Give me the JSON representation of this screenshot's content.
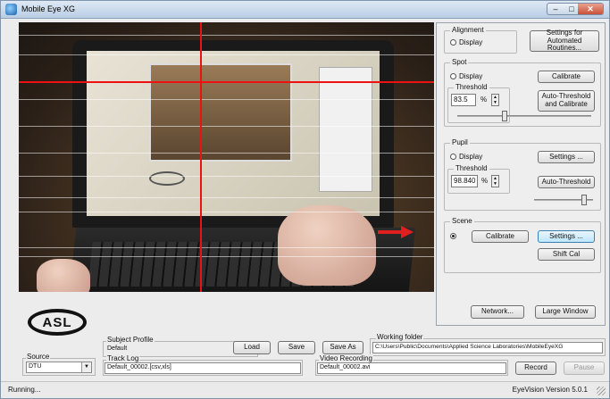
{
  "window": {
    "title": "Mobile Eye XG"
  },
  "alignment": {
    "label": "Alignment",
    "display_label": "Display",
    "settings_button": "Settings for\nAutomated Routines..."
  },
  "spot": {
    "label": "Spot",
    "display_label": "Display",
    "calibrate_button": "Calibrate",
    "threshold_label": "Threshold",
    "threshold_value": "83.5",
    "percent": "%",
    "auto_button": "Auto-Threshold\nand Calibrate",
    "slider_level": 0.35
  },
  "pupil": {
    "label": "Pupil",
    "display_label": "Display",
    "settings_button": "Settings ...",
    "threshold_label": "Threshold",
    "threshold_value": "98.840",
    "percent": "%",
    "auto_button": "Auto-Threshold",
    "slider_level": 0.85
  },
  "scene": {
    "label": "Scene",
    "calibrate_button": "Calibrate",
    "settings_button": "Settings ...",
    "shift_button": "Shift Cal"
  },
  "panel_buttons": {
    "network": "Network...",
    "large_window": "Large Window"
  },
  "logo": "ASL",
  "subject_profile": {
    "label": "Subject Profile",
    "value": "Default",
    "load": "Load",
    "save": "Save",
    "save_as": "Save As"
  },
  "working_folder": {
    "label": "Working folder",
    "value": "C:\\Users\\Public\\Documents\\Applied Science Laboratories\\MobileEyeXG"
  },
  "source": {
    "label": "Source",
    "value": "DTU"
  },
  "track_log": {
    "label": "Track Log",
    "value": "Default_00002.[csv,xls]"
  },
  "video_recording": {
    "label": "Video Recording",
    "value": "Default_00002.avi",
    "record": "Record",
    "pause": "Pause"
  },
  "status": {
    "left": "Running...",
    "right": "EyeVision   Version 5.0.1"
  },
  "colors": {
    "crosshair": "#ee1111",
    "arrow": "#e02020"
  }
}
